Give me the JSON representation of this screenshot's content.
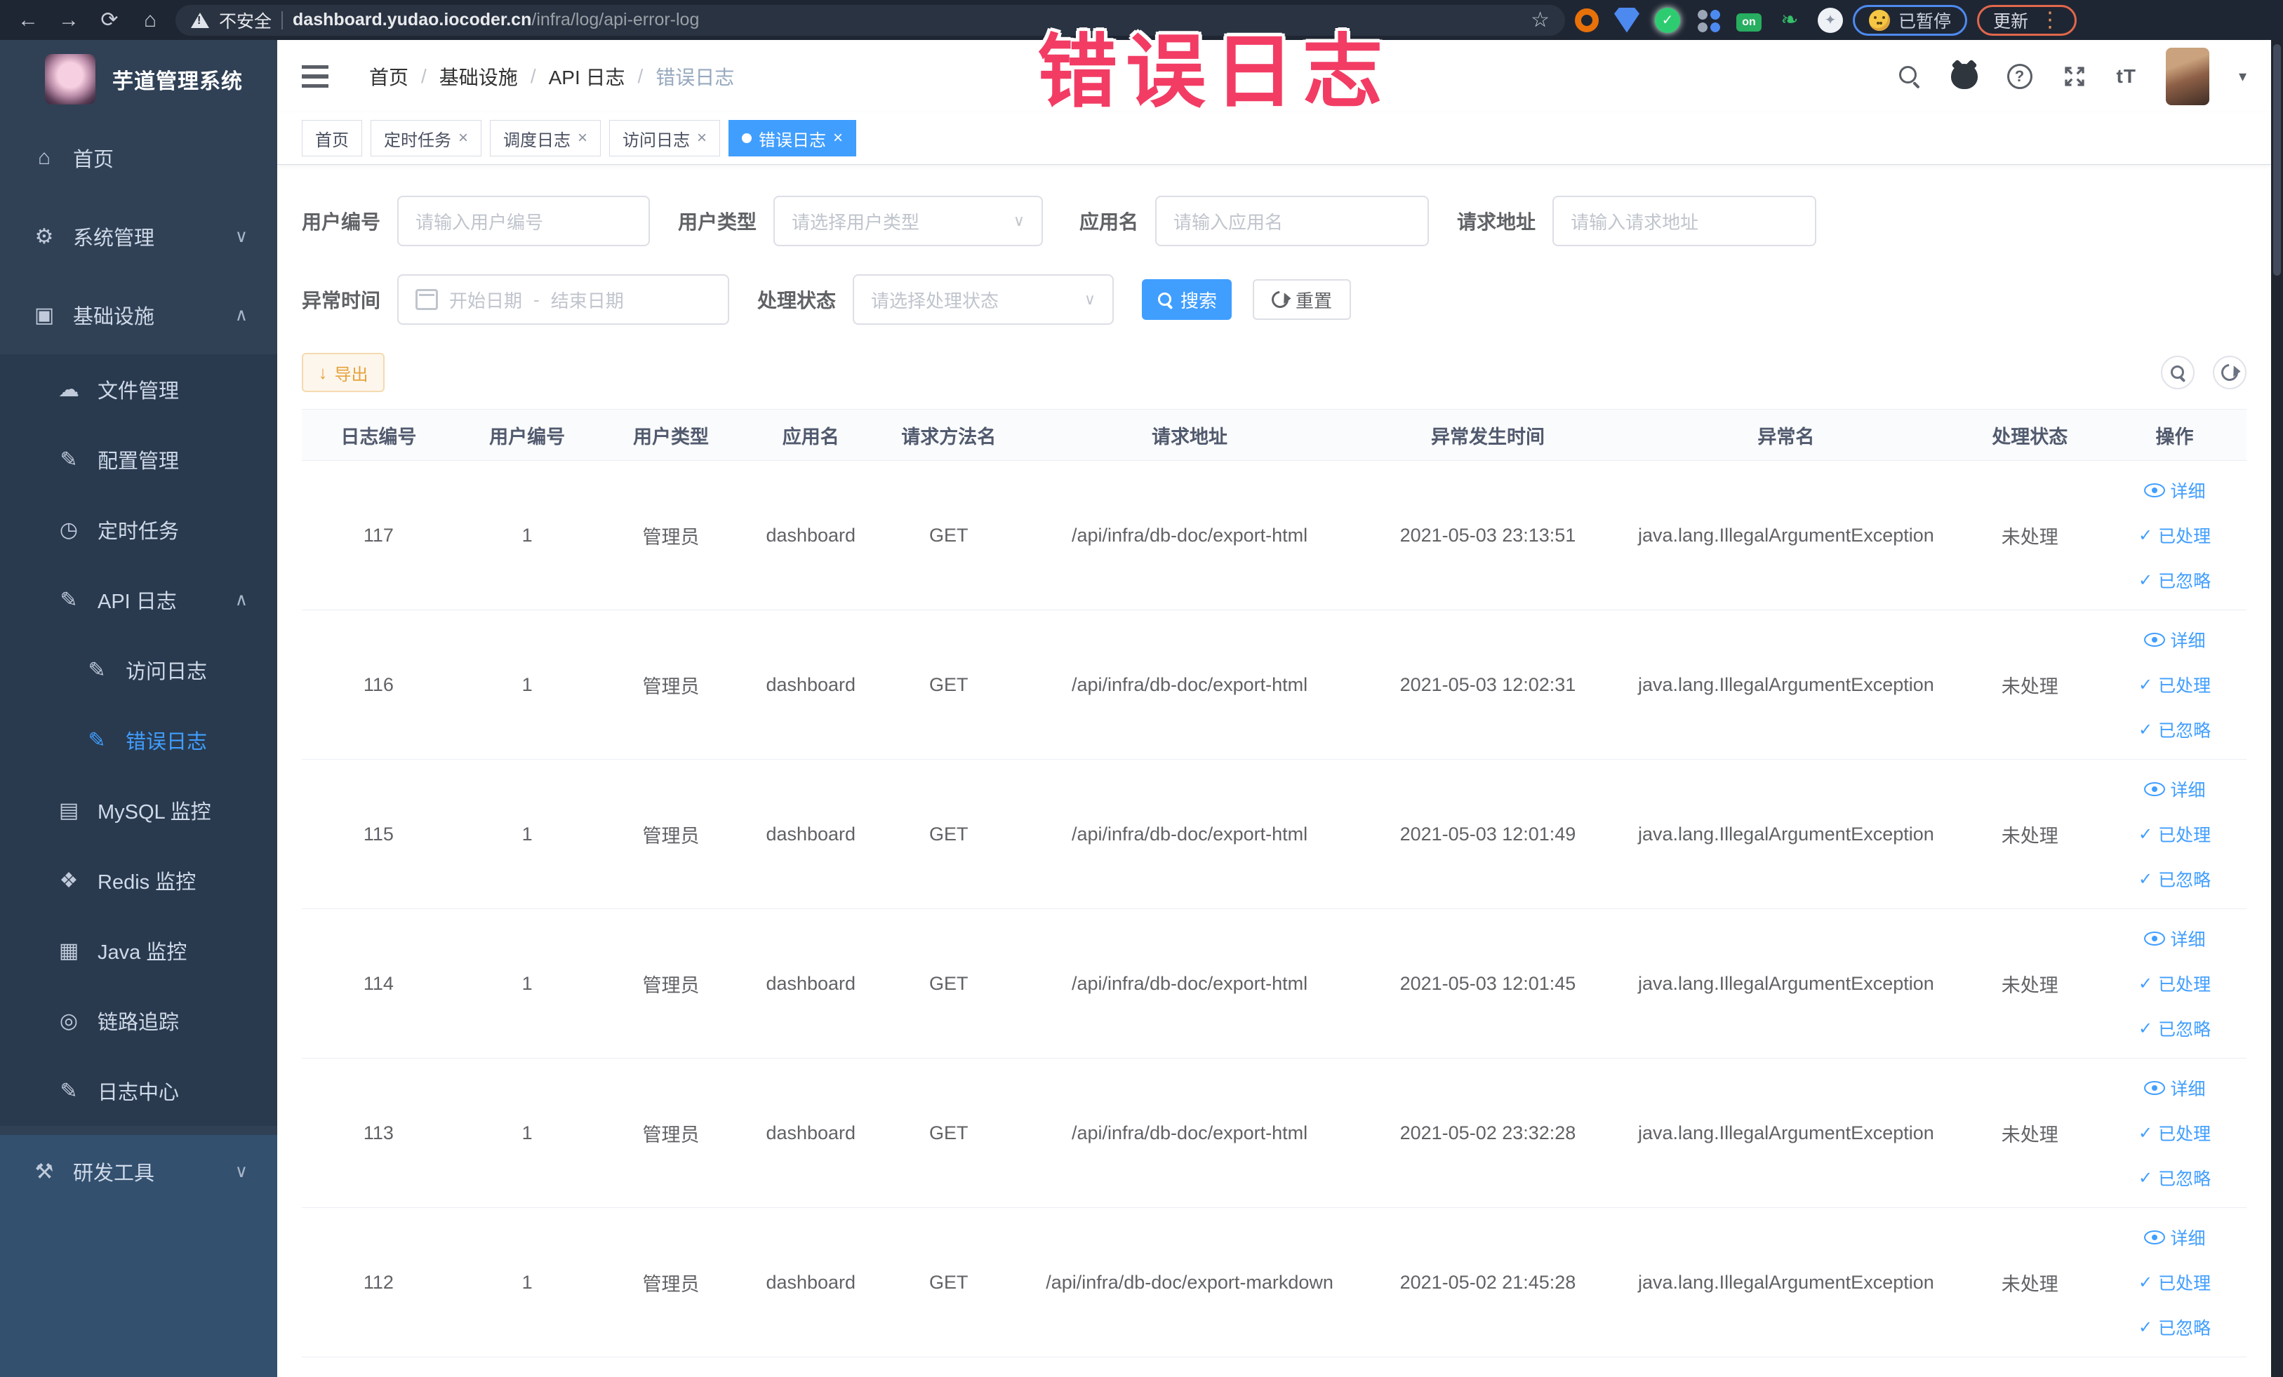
{
  "colors": {
    "accent": "#409eff",
    "warning": "#e6a23c",
    "overlay_pink": "#f23c64",
    "chrome_bg": "#1f2633",
    "sidebar_bg": "#304156"
  },
  "overlay": {
    "text": "错误日志"
  },
  "browser": {
    "security_label": "不安全",
    "url_host": "dashboard.yudao.iocoder.cn",
    "url_path": "/infra/log/api-error-log",
    "star_icon": "☆",
    "extensions": [
      {
        "name": "ext-orange-ring"
      },
      {
        "name": "ext-blue-shield"
      },
      {
        "name": "ext-green-check",
        "glyph": "✓"
      },
      {
        "name": "ext-grid"
      },
      {
        "name": "ext-on-badge",
        "glyph": "on"
      },
      {
        "name": "ext-leaf",
        "glyph": "❧"
      },
      {
        "name": "ext-puzzle",
        "glyph": "✦"
      }
    ],
    "paused_label": "已暂停",
    "update_label": "更新"
  },
  "icons": {
    "back": "←",
    "forward": "→",
    "reload": "⟳",
    "home": "⌂",
    "close": "×",
    "caret_down": "∨",
    "caret_up": "∧",
    "check": "✓",
    "dropdown": "∨",
    "kebab": "⋮",
    "caret_small": "▾",
    "font_size": "tT",
    "download": "↓"
  },
  "sidebar": {
    "title": "芋道管理系统",
    "items": [
      {
        "label": "首页",
        "icon": "home-icon",
        "glyph": "⌂",
        "depth": 0
      },
      {
        "label": "系统管理",
        "icon": "gear-icon",
        "glyph": "⚙",
        "depth": 0,
        "arrow": "caret_down"
      },
      {
        "label": "基础设施",
        "icon": "monitor-icon",
        "glyph": "▣",
        "depth": 0,
        "arrow": "caret_up"
      },
      {
        "label": "文件管理",
        "icon": "cloud-upload-icon",
        "glyph": "☁",
        "depth": 1
      },
      {
        "label": "配置管理",
        "icon": "edit-square-icon",
        "glyph": "✎",
        "depth": 1
      },
      {
        "label": "定时任务",
        "icon": "timer-icon",
        "glyph": "◷",
        "depth": 1
      },
      {
        "label": "API 日志",
        "icon": "log-edit-icon",
        "glyph": "✎",
        "depth": 1,
        "arrow": "caret_up"
      },
      {
        "label": "访问日志",
        "icon": "log-edit-icon",
        "glyph": "✎",
        "depth": 2
      },
      {
        "label": "错误日志",
        "icon": "log-edit-icon",
        "glyph": "✎",
        "depth": 2,
        "active": true
      },
      {
        "label": "MySQL 监控",
        "icon": "chart-icon",
        "glyph": "▤",
        "depth": 1
      },
      {
        "label": "Redis 监控",
        "icon": "database-icon",
        "glyph": "❖",
        "depth": 1
      },
      {
        "label": "Java 监控",
        "icon": "java-monitor-icon",
        "glyph": "▦",
        "depth": 1
      },
      {
        "label": "链路追踪",
        "icon": "trace-eye-icon",
        "glyph": "◎",
        "depth": 1
      },
      {
        "label": "日志中心",
        "icon": "log-center-icon",
        "glyph": "✎",
        "depth": 1
      },
      {
        "label": "研发工具",
        "icon": "toolbox-icon",
        "glyph": "⚒",
        "depth": 0,
        "arrow": "caret_down",
        "section": "light"
      }
    ]
  },
  "header": {
    "breadcrumb": [
      "首页",
      "基础设施",
      "API 日志",
      "错误日志"
    ]
  },
  "tabs": [
    {
      "label": "首页",
      "closable": false,
      "active": false
    },
    {
      "label": "定时任务",
      "closable": true,
      "active": false
    },
    {
      "label": "调度日志",
      "closable": true,
      "active": false
    },
    {
      "label": "访问日志",
      "closable": true,
      "active": false
    },
    {
      "label": "错误日志",
      "closable": true,
      "active": true
    }
  ],
  "filters": {
    "user_id": {
      "label": "用户编号",
      "placeholder": "请输入用户编号"
    },
    "user_type": {
      "label": "用户类型",
      "placeholder": "请选择用户类型"
    },
    "app_name": {
      "label": "应用名",
      "placeholder": "请输入应用名"
    },
    "request_url": {
      "label": "请求地址",
      "placeholder": "请输入请求地址"
    },
    "exception_time": {
      "label": "异常时间",
      "start_placeholder": "开始日期",
      "separator": "-",
      "end_placeholder": "结束日期"
    },
    "process_status": {
      "label": "处理状态",
      "placeholder": "请选择处理状态"
    },
    "search_label": "搜索",
    "reset_label": "重置"
  },
  "toolbar": {
    "export_label": "导出"
  },
  "table": {
    "columns": [
      "日志编号",
      "用户编号",
      "用户类型",
      "应用名",
      "请求方法名",
      "请求地址",
      "异常发生时间",
      "异常名",
      "处理状态",
      "操作"
    ],
    "rows": [
      {
        "id": "117",
        "user_id": "1",
        "user_type": "管理员",
        "app": "dashboard",
        "method": "GET",
        "url": "/api/infra/db-doc/export-html",
        "time": "2021-05-03 23:13:51",
        "exception": "java.lang.IllegalArgumentException",
        "status": "未处理"
      },
      {
        "id": "116",
        "user_id": "1",
        "user_type": "管理员",
        "app": "dashboard",
        "method": "GET",
        "url": "/api/infra/db-doc/export-html",
        "time": "2021-05-03 12:02:31",
        "exception": "java.lang.IllegalArgumentException",
        "status": "未处理"
      },
      {
        "id": "115",
        "user_id": "1",
        "user_type": "管理员",
        "app": "dashboard",
        "method": "GET",
        "url": "/api/infra/db-doc/export-html",
        "time": "2021-05-03 12:01:49",
        "exception": "java.lang.IllegalArgumentException",
        "status": "未处理"
      },
      {
        "id": "114",
        "user_id": "1",
        "user_type": "管理员",
        "app": "dashboard",
        "method": "GET",
        "url": "/api/infra/db-doc/export-html",
        "time": "2021-05-03 12:01:45",
        "exception": "java.lang.IllegalArgumentException",
        "status": "未处理"
      },
      {
        "id": "113",
        "user_id": "1",
        "user_type": "管理员",
        "app": "dashboard",
        "method": "GET",
        "url": "/api/infra/db-doc/export-html",
        "time": "2021-05-02 23:32:28",
        "exception": "java.lang.IllegalArgumentException",
        "status": "未处理"
      },
      {
        "id": "112",
        "user_id": "1",
        "user_type": "管理员",
        "app": "dashboard",
        "method": "GET",
        "url": "/api/infra/db-doc/export-markdown",
        "time": "2021-05-02 21:45:28",
        "exception": "java.lang.IllegalArgumentException",
        "status": "未处理"
      }
    ],
    "actions": [
      {
        "label": "详细",
        "icon": "eye-icon"
      },
      {
        "label": "已处理",
        "icon": "check-icon"
      },
      {
        "label": "已忽略",
        "icon": "check-icon"
      }
    ]
  }
}
